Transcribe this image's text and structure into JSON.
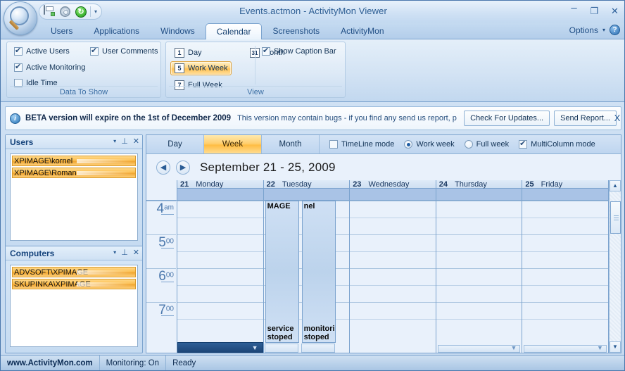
{
  "window": {
    "title": "Events.actmon  -  ActivityMon Viewer",
    "minimize": "–",
    "maximize": "❐",
    "close": "✕"
  },
  "quick_access": {
    "print": "print-icon",
    "settings": "gear-icon",
    "refresh": "refresh-icon",
    "more": "▾"
  },
  "tabs": [
    {
      "label": "Users",
      "active": false
    },
    {
      "label": "Applications",
      "active": false
    },
    {
      "label": "Windows",
      "active": false
    },
    {
      "label": "Calendar",
      "active": true
    },
    {
      "label": "Screenshots",
      "active": false
    },
    {
      "label": "ActivityMon",
      "active": false
    }
  ],
  "options": {
    "label": "Options",
    "caret": "▾",
    "help": "?"
  },
  "ribbon": {
    "data_group": {
      "label": "Data To Show",
      "items": [
        {
          "label": "Active Users",
          "checked": true
        },
        {
          "label": "User Comments",
          "checked": true
        },
        {
          "label": "Active Monitoring",
          "checked": true
        },
        {
          "label": "Idle Time",
          "checked": false
        }
      ]
    },
    "view_group": {
      "label": "View",
      "buttons": [
        {
          "label": "Day",
          "icon": "1",
          "selected": false
        },
        {
          "label": "Month",
          "icon": "31",
          "selected": false
        },
        {
          "label": "Work Week",
          "icon": "5",
          "selected": true
        },
        {
          "label": "Full Week",
          "icon": "7",
          "selected": false
        }
      ],
      "caption_bar": {
        "label": "Show Caption Bar",
        "checked": true
      }
    }
  },
  "beta_bar": {
    "icon": "i",
    "headline": "BETA version will expire on the 1st of December 2009",
    "subtext": "This version may contain bugs - if you find any send us report, p",
    "check_updates": "Check For Updates...",
    "send_report": "Send Report...",
    "close": "X"
  },
  "panels": {
    "users": {
      "title": "Users",
      "caret": "▾",
      "pin": "📌",
      "close": "✕",
      "items": [
        "XPIMAGE\\kornel",
        "XPIMAGE\\Roman"
      ]
    },
    "computers": {
      "title": "Computers",
      "caret": "▾",
      "pin": "📌",
      "close": "✕",
      "items": [
        "ADVSOFT\\XPIMAGE",
        "SKUPINKA\\XPIMAGE"
      ]
    }
  },
  "calendar": {
    "view_buttons": [
      {
        "label": "Day",
        "selected": false
      },
      {
        "label": "Week",
        "selected": true
      },
      {
        "label": "Month",
        "selected": false
      }
    ],
    "options": [
      {
        "label": "TimeLine mode",
        "type": "checkbox",
        "checked": false
      },
      {
        "label": "Work week",
        "type": "radio",
        "checked": true
      },
      {
        "label": "Full week",
        "type": "radio",
        "checked": false
      },
      {
        "label": "MultiColumn mode",
        "type": "checkbox",
        "checked": true
      }
    ],
    "prev": "◀",
    "next": "▶",
    "date_range": "September 21 - 25, 2009",
    "days": [
      {
        "num": "21",
        "name": "Monday"
      },
      {
        "num": "22",
        "name": "Tuesday"
      },
      {
        "num": "23",
        "name": "Wednesday"
      },
      {
        "num": "24",
        "name": "Thursday"
      },
      {
        "num": "25",
        "name": "Friday"
      }
    ],
    "hours": [
      {
        "h": "4",
        "m": "am"
      },
      {
        "h": "5",
        "m": "00"
      },
      {
        "h": "6",
        "m": "00"
      },
      {
        "h": "7",
        "m": "00"
      }
    ],
    "events": [
      {
        "day": "Tuesday",
        "top_text": "MAGE",
        "bottom_text": "service stoped"
      },
      {
        "day": "Tuesday",
        "top_text": "nel",
        "bottom_text": "monitoring stoped"
      }
    ],
    "scroll": {
      "up": "▲",
      "down": "▼",
      "hthumb": "▼"
    }
  },
  "statusbar": {
    "site": "www.ActivityMon.com",
    "monitoring": "Monitoring: On",
    "state": "Ready"
  },
  "colors": {
    "accent_orange": "#ffc254",
    "frame_blue": "#7ba3ce",
    "title_blue": "#2c5d93",
    "allday_band": "#a9c3e6"
  }
}
